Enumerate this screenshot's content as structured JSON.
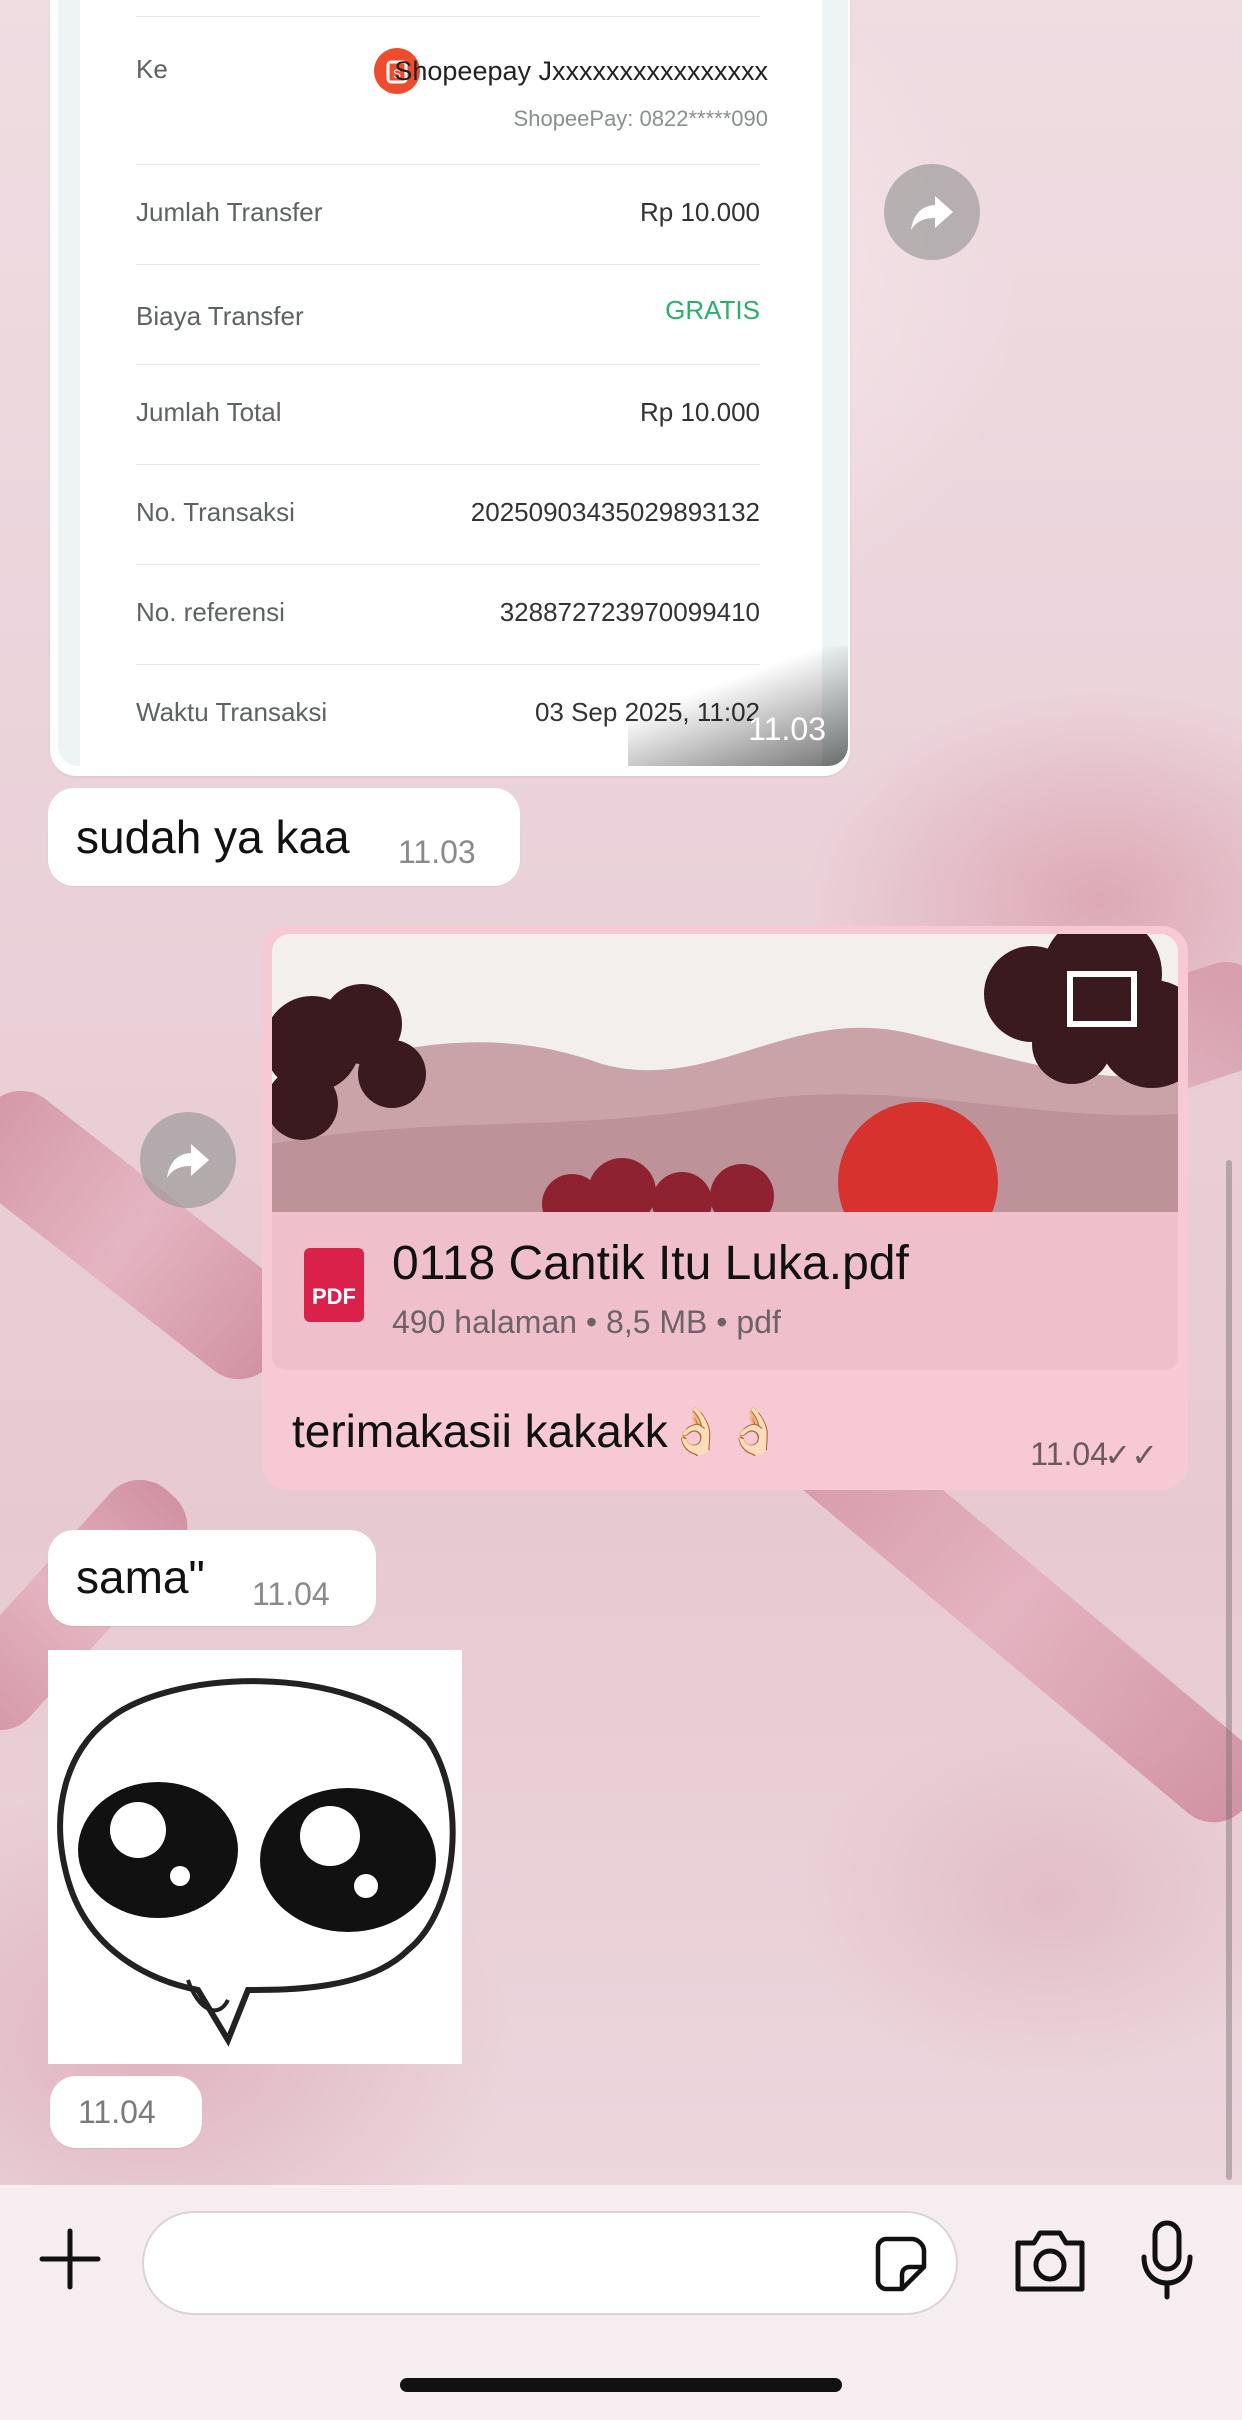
{
  "receipt": {
    "to_label": "Ke",
    "to_name": "Shopeepay Jxxxxxxxxxxxxxxxx",
    "to_sub": "ShopeePay: 0822*****090",
    "rows": [
      {
        "label": "Jumlah Transfer",
        "value": "Rp 10.000"
      },
      {
        "label": "Biaya Transfer",
        "value": "GRATIS"
      },
      {
        "label": "Jumlah Total",
        "value": "Rp 10.000"
      },
      {
        "label": "No. Transaksi",
        "value": "20250903435029893132"
      },
      {
        "label": "No. referensi",
        "value": "328872723970099410"
      },
      {
        "label": "Waktu Transaksi",
        "value": "03 Sep 2025, 11:02"
      }
    ],
    "time": "11.03",
    "free_color": "#2bb06a"
  },
  "messages": {
    "m1": {
      "text": "sudah ya kaa",
      "time": "11.03"
    },
    "doc": {
      "name": "0118 Cantik Itu Luka.pdf",
      "meta": "490 halaman • 8,5 MB • pdf",
      "icon_label": "PDF",
      "caption": "terimakasii kakakk👌🏻👌🏻",
      "time": "11.04",
      "ticks": "✓✓"
    },
    "m3": {
      "text": "sama\"",
      "time": "11.04"
    },
    "sticker_time": "11.04"
  },
  "composer": {
    "placeholder": ""
  },
  "colors": {
    "bubble_out": "#f7c9d5",
    "pdf_red": "#d9214a",
    "shopee_orange": "#ee4d2d"
  }
}
